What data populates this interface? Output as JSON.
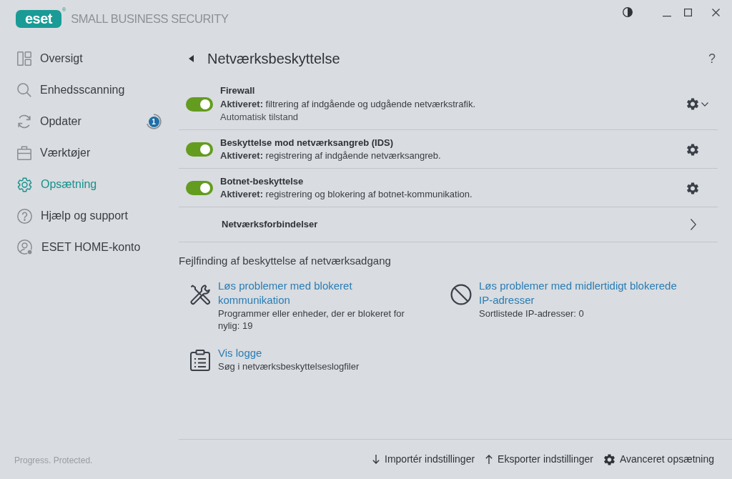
{
  "header": {
    "logo_text": "eset",
    "logo_mark": "®",
    "product_name": "SMALL BUSINESS SECURITY"
  },
  "sidebar": {
    "items": [
      {
        "label": "Oversigt",
        "selected": false
      },
      {
        "label": "Enhedsscanning",
        "selected": false
      },
      {
        "label": "Opdater",
        "selected": false,
        "badge": "1"
      },
      {
        "label": "Værktøjer",
        "selected": false
      },
      {
        "label": "Opsætning",
        "selected": true
      },
      {
        "label": "Hjælp og support",
        "selected": false
      },
      {
        "label": "ESET HOME-konto",
        "selected": false
      }
    ],
    "tagline": "Progress. Protected."
  },
  "page": {
    "title": "Netværksbeskyttelse",
    "help": "?"
  },
  "settings": [
    {
      "kind": "toggle",
      "title": "Firewall",
      "description": "**Aktiveret:** filtrering af indgående og udgående netværkstrafik.",
      "note": "Automatisk tilstand",
      "on": true,
      "has_menu": true
    },
    {
      "kind": "toggle",
      "title": "Beskyttelse mod netværksangreb (IDS)",
      "description": "**Aktiveret:** registrering af indgående netværksangreb.",
      "on": true,
      "has_menu": false
    },
    {
      "kind": "toggle",
      "title": "Botnet-beskyttelse",
      "description": "**Aktiveret:** registrering og blokering af botnet-kommunikation.",
      "on": true,
      "has_menu": false
    },
    {
      "kind": "link",
      "title": "Netværksforbindelser"
    }
  ],
  "troubleshooting": {
    "title": "Fejlfinding af beskyttelse af netværksadgang",
    "items": [
      {
        "title": "Løs problemer med blokeret kommunikation",
        "description": "Programmer eller enheder, der er blokeret for nylig: 19"
      },
      {
        "title": "Løs problemer med midlertidigt blokerede IP-adresser",
        "description": "Sortlistede IP-adresser: 0"
      },
      {
        "title": "Vis logge",
        "description": "Søg i netværksbeskyttelseslogfiler"
      }
    ]
  },
  "footer": {
    "actions": [
      "Importér indstillinger",
      "Eksporter indstillinger",
      "Avanceret opsætning"
    ]
  }
}
